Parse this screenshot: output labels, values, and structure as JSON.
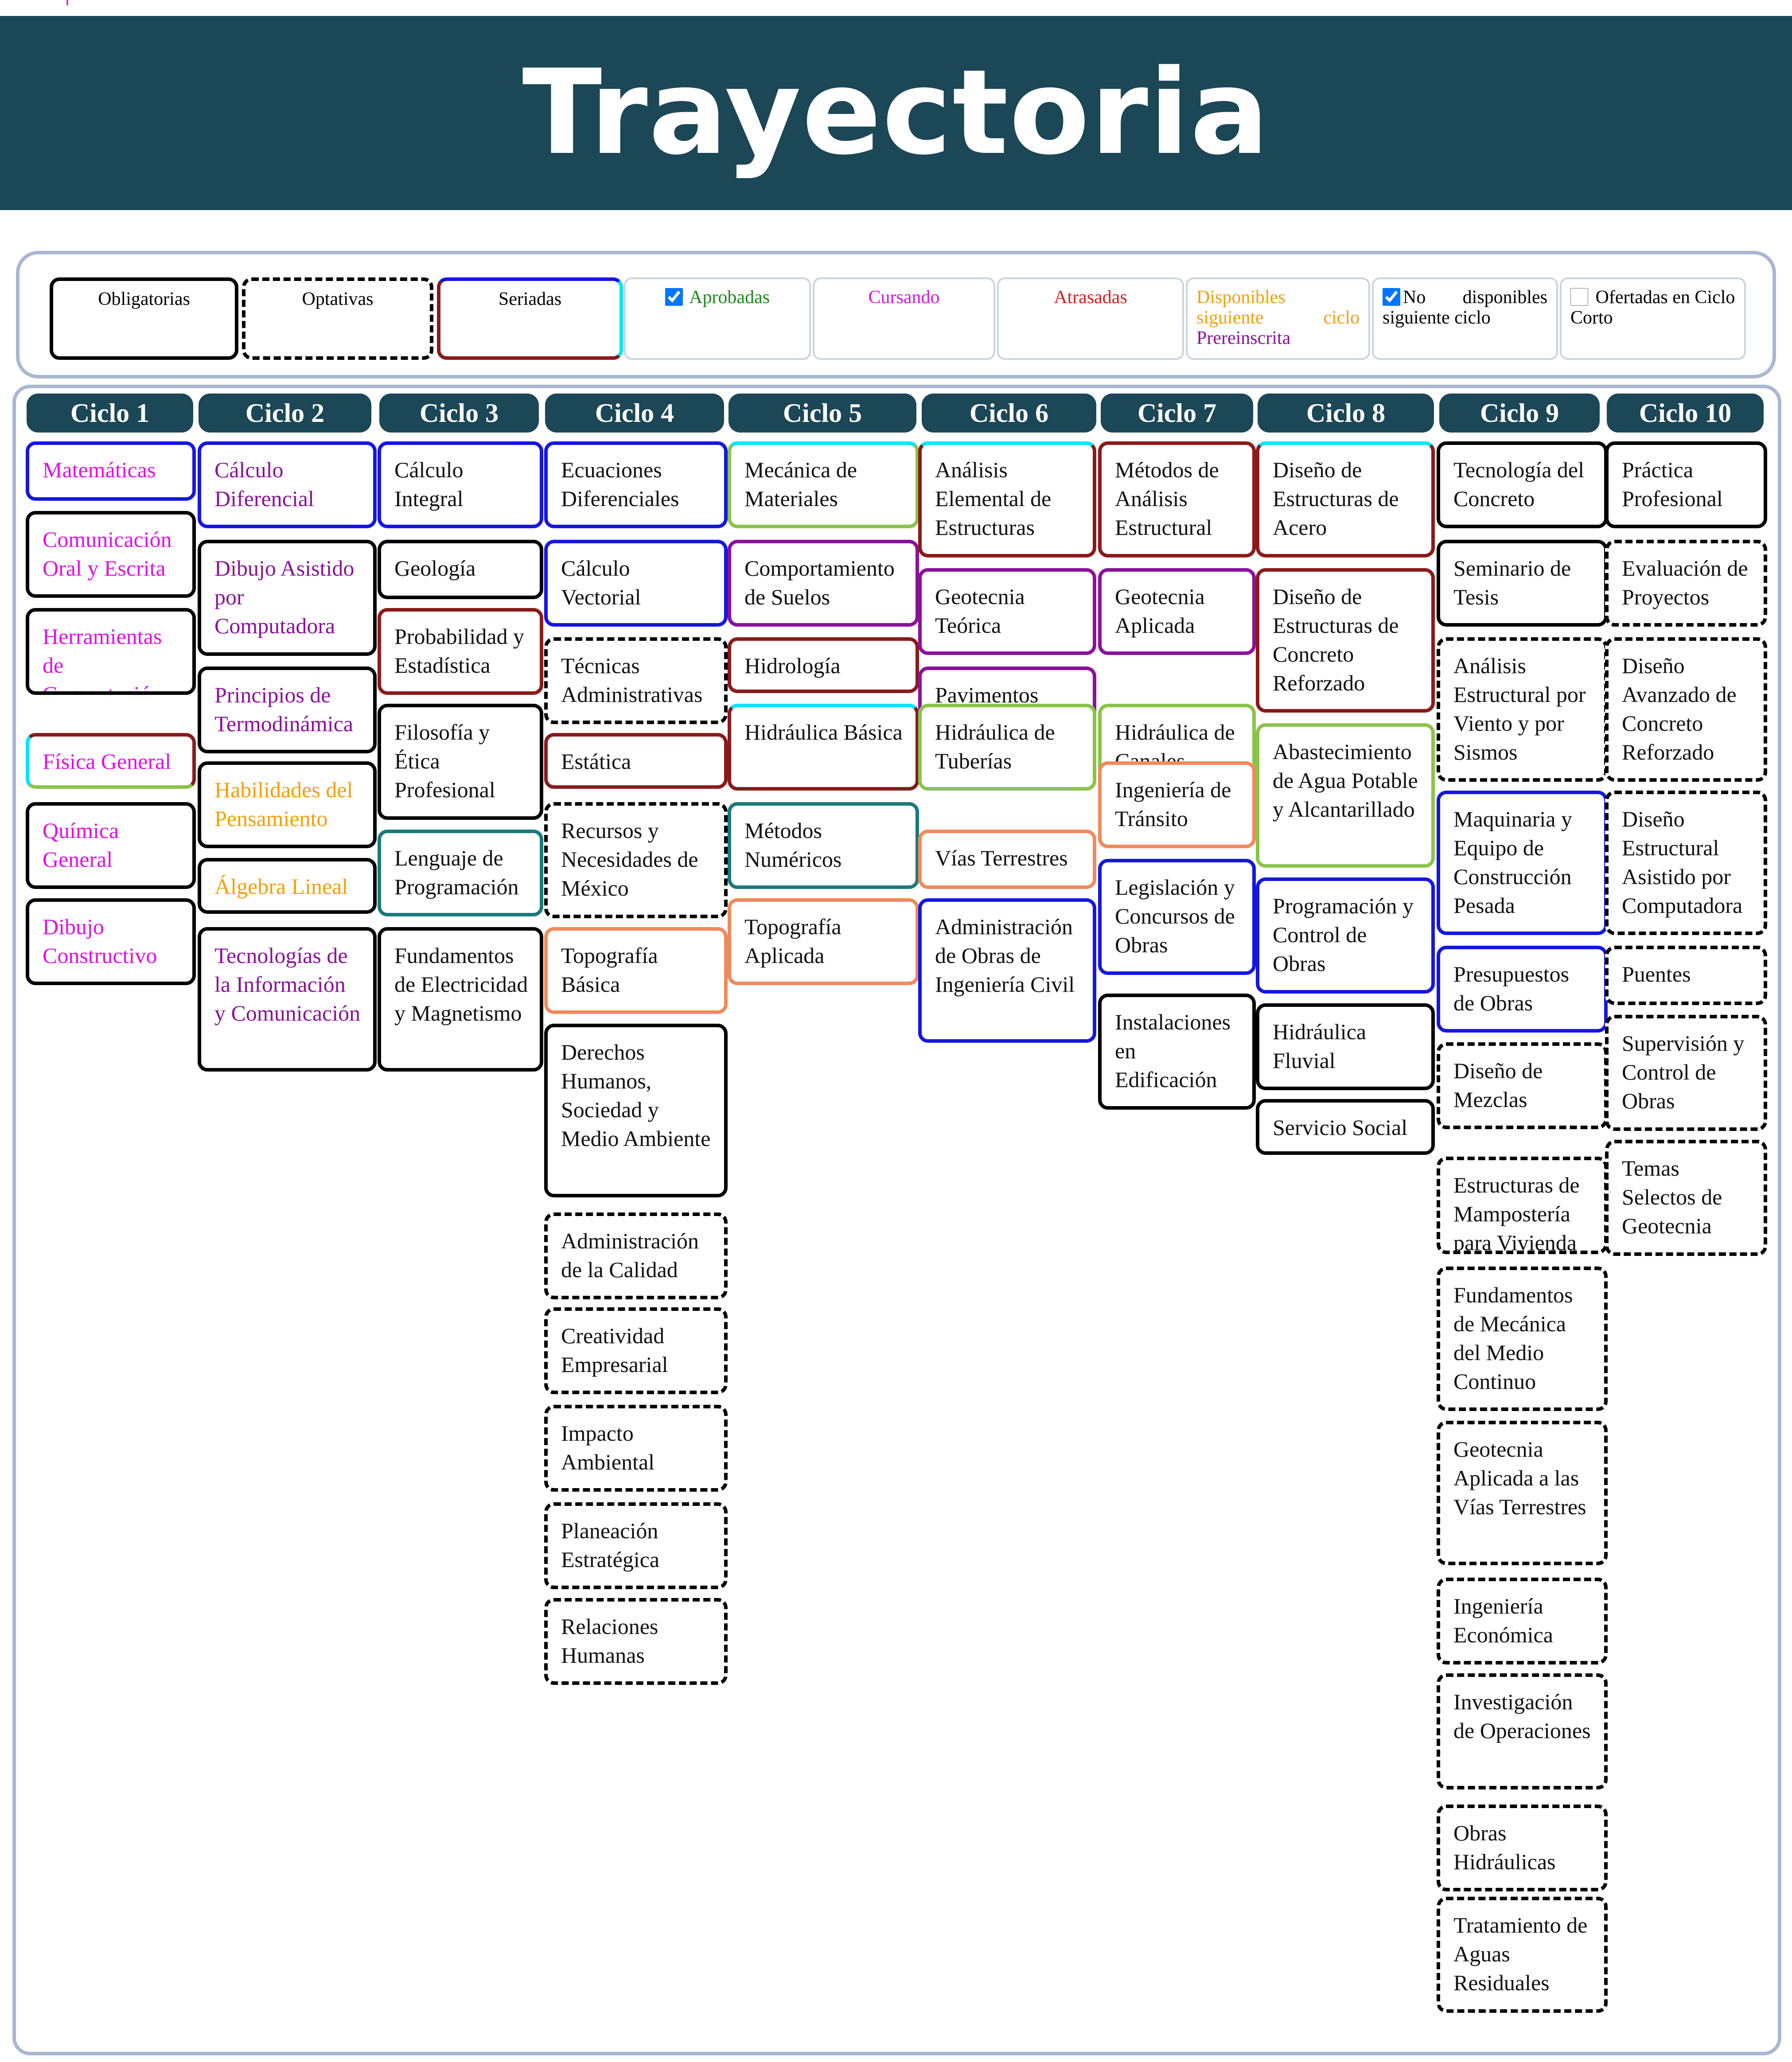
{
  "page": {
    "title": "Trayectoria"
  },
  "legend": {
    "obligatorias": "Obligatorias",
    "optativas": "Optativas",
    "seriadas": "Seriadas",
    "aprobadas": "Aprobadas",
    "aprobadas_checked": true,
    "cursando": "Cursando",
    "atrasadas": "Atrasadas",
    "disponibles_line1": "Disponibles",
    "disponibles_line2a": "siguiente",
    "disponibles_line2b": "ciclo",
    "prereinscrita": "Prereinscrita",
    "no_disponibles_a": "No",
    "no_disponibles_b": "disponibles",
    "no_disponibles_line2": "siguiente ciclo",
    "no_disponibles_checked": true,
    "ofertadas": "Ofertadas en Ciclo Corto",
    "ofertadas_checked": false
  },
  "colors": {
    "header_bg": "#1b4756",
    "panel_border": "#a9b7d3",
    "magenta_text": "#e20fe5",
    "purple_text": "#8b119b",
    "orange_text": "#f59e0b",
    "green_text": "#1a8a1a",
    "red_text": "#e01b1b",
    "border_black": "#000000",
    "border_blue": "#1616e0",
    "border_darkred": "#8b1a1a",
    "border_purple": "#8b119b",
    "border_teal": "#1b7a7a",
    "border_lime": "#8bc34a",
    "border_salmon": "#f08a5d",
    "border_cyan": "#00e5ff"
  },
  "cycles": [
    {
      "label": "Ciclo 1",
      "courses": [
        {
          "name": "Matemáticas",
          "text": "magenta",
          "border": "blue",
          "style": "solid"
        },
        {
          "name": "Comunicación Oral y Escrita",
          "text": "magenta",
          "border": "black",
          "style": "solid"
        },
        {
          "name": "Herramientas de Computación",
          "text": "magenta",
          "border": "black",
          "style": "solid"
        },
        {
          "name": "Física General",
          "text": "magenta",
          "border": "red-cyan",
          "style": "solid"
        },
        {
          "name": "Química General",
          "text": "magenta",
          "border": "black",
          "style": "solid"
        },
        {
          "name": "Dibujo Constructivo",
          "text": "magenta",
          "border": "black",
          "style": "solid"
        }
      ]
    },
    {
      "label": "Ciclo 2",
      "courses": [
        {
          "name": "Cálculo Diferencial",
          "text": "purple",
          "border": "blue",
          "style": "solid"
        },
        {
          "name": "Dibujo Asistido por Computadora",
          "text": "purple",
          "border": "black",
          "style": "solid"
        },
        {
          "name": "Principios de Termodinámica",
          "text": "purple",
          "border": "black",
          "style": "solid"
        },
        {
          "name": "Habilidades del Pensamiento",
          "text": "orange",
          "border": "black",
          "style": "solid"
        },
        {
          "name": "Álgebra Lineal",
          "text": "orange",
          "border": "black",
          "style": "solid"
        },
        {
          "name": "Tecnologías de la Información y Comunicación",
          "text": "purple",
          "border": "black",
          "style": "solid"
        }
      ]
    },
    {
      "label": "Ciclo 3",
      "courses": [
        {
          "name": "Cálculo Integral",
          "text": "black",
          "border": "blue",
          "style": "solid"
        },
        {
          "name": "Geología",
          "text": "black",
          "border": "black",
          "style": "solid"
        },
        {
          "name": "Probabilidad y Estadística",
          "text": "black",
          "border": "darkred",
          "style": "solid"
        },
        {
          "name": "Filosofía y Ética Profesional",
          "text": "black",
          "border": "black",
          "style": "solid"
        },
        {
          "name": "Lenguaje de Programación",
          "text": "black",
          "border": "teal",
          "style": "solid"
        },
        {
          "name": "Fundamentos de Electricidad y Magnetismo",
          "text": "black",
          "border": "black",
          "style": "solid"
        }
      ]
    },
    {
      "label": "Ciclo 4",
      "courses": [
        {
          "name": "Ecuaciones Diferenciales",
          "text": "black",
          "border": "blue",
          "style": "solid"
        },
        {
          "name": "Cálculo Vectorial",
          "text": "black",
          "border": "blue",
          "style": "solid"
        },
        {
          "name": "Técnicas Administrativas",
          "text": "black",
          "border": "black",
          "style": "dashed"
        },
        {
          "name": "Estática",
          "text": "black",
          "border": "darkred",
          "style": "solid"
        },
        {
          "name": "Recursos y Necesidades de México",
          "text": "black",
          "border": "black",
          "style": "dashed"
        },
        {
          "name": "Topografía Básica",
          "text": "black",
          "border": "salmon",
          "style": "solid"
        },
        {
          "name": "Derechos Humanos, Sociedad y Medio Ambiente",
          "text": "black",
          "border": "black",
          "style": "solid"
        },
        {
          "name": "Administración de la Calidad",
          "text": "black",
          "border": "black",
          "style": "dashed"
        },
        {
          "name": "Creatividad Empresarial",
          "text": "black",
          "border": "black",
          "style": "dashed"
        },
        {
          "name": "Impacto Ambiental",
          "text": "black",
          "border": "black",
          "style": "dashed"
        },
        {
          "name": "Planeación Estratégica",
          "text": "black",
          "border": "black",
          "style": "dashed"
        },
        {
          "name": "Relaciones Humanas",
          "text": "black",
          "border": "black",
          "style": "dashed"
        }
      ]
    },
    {
      "label": "Ciclo 5",
      "courses": [
        {
          "name": "Mecánica de Materiales",
          "text": "black",
          "border": "cyan-lime",
          "style": "solid"
        },
        {
          "name": "Comportamiento de Suelos",
          "text": "black",
          "border": "purple",
          "style": "solid"
        },
        {
          "name": "Hidrología",
          "text": "black",
          "border": "darkred",
          "style": "solid"
        },
        {
          "name": "Hidráulica Básica",
          "text": "black",
          "border": "cyan-darkred",
          "style": "solid"
        },
        {
          "name": "Métodos Numéricos",
          "text": "black",
          "border": "teal",
          "style": "solid"
        },
        {
          "name": "Topografía Aplicada",
          "text": "black",
          "border": "salmon",
          "style": "solid"
        }
      ]
    },
    {
      "label": "Ciclo 6",
      "courses": [
        {
          "name": "Análisis Elemental de Estructuras",
          "text": "black",
          "border": "cyan-darkred",
          "style": "solid"
        },
        {
          "name": "Geotecnia Teórica",
          "text": "black",
          "border": "purple",
          "style": "solid"
        },
        {
          "name": "Pavimentos",
          "text": "black",
          "border": "purple",
          "style": "solid"
        },
        {
          "name": "Hidráulica de Tuberías",
          "text": "black",
          "border": "lime",
          "style": "solid"
        },
        {
          "name": "Vías Terrestres",
          "text": "black",
          "border": "salmon",
          "style": "solid"
        },
        {
          "name": "Administración de Obras de Ingeniería Civil",
          "text": "black",
          "border": "blue",
          "style": "solid"
        }
      ]
    },
    {
      "label": "Ciclo 7",
      "courses": [
        {
          "name": "Métodos de Análisis Estructural",
          "text": "black",
          "border": "darkred",
          "style": "solid"
        },
        {
          "name": "Geotecnia Aplicada",
          "text": "black",
          "border": "purple",
          "style": "solid"
        },
        {
          "name": "Hidráulica de Canales",
          "text": "black",
          "border": "lime",
          "style": "solid"
        },
        {
          "name": "Ingeniería de Tránsito",
          "text": "black",
          "border": "salmon",
          "style": "solid"
        },
        {
          "name": "Legislación y Concursos de Obras",
          "text": "black",
          "border": "blue",
          "style": "solid"
        },
        {
          "name": "Instalaciones en Edificación",
          "text": "black",
          "border": "black",
          "style": "solid"
        }
      ]
    },
    {
      "label": "Ciclo 8",
      "courses": [
        {
          "name": "Diseño de Estructuras de Acero",
          "text": "black",
          "border": "cyan-darkred",
          "style": "solid"
        },
        {
          "name": "Diseño de Estructuras de Concreto Reforzado",
          "text": "black",
          "border": "darkred",
          "style": "solid"
        },
        {
          "name": "Abastecimiento de Agua Potable y Alcantarillado",
          "text": "black",
          "border": "lime",
          "style": "solid"
        },
        {
          "name": "Programación y Control de Obras",
          "text": "black",
          "border": "blue",
          "style": "solid"
        },
        {
          "name": "Hidráulica Fluvial",
          "text": "black",
          "border": "black",
          "style": "solid"
        },
        {
          "name": "Servicio Social",
          "text": "black",
          "border": "black",
          "style": "solid"
        }
      ]
    },
    {
      "label": "Ciclo 9",
      "courses": [
        {
          "name": "Tecnología del Concreto",
          "text": "black",
          "border": "black",
          "style": "solid"
        },
        {
          "name": "Seminario de Tesis",
          "text": "black",
          "border": "black",
          "style": "solid"
        },
        {
          "name": "Análisis Estructural por Viento y por Sismos",
          "text": "black",
          "border": "black",
          "style": "dashed"
        },
        {
          "name": "Maquinaria y Equipo de Construcción Pesada",
          "text": "black",
          "border": "blue",
          "style": "solid"
        },
        {
          "name": "Presupuestos de Obras",
          "text": "black",
          "border": "blue",
          "style": "solid"
        },
        {
          "name": "Diseño de Mezclas",
          "text": "black",
          "border": "black",
          "style": "dashed"
        },
        {
          "name": "Estructuras de Mampostería para Vivienda",
          "text": "black",
          "border": "black",
          "style": "dashed"
        },
        {
          "name": "Fundamentos de Mecánica del Medio Continuo",
          "text": "black",
          "border": "black",
          "style": "dashed"
        },
        {
          "name": "Geotecnia Aplicada a las Vías Terrestres",
          "text": "black",
          "border": "black",
          "style": "dashed"
        },
        {
          "name": "Ingeniería Económica",
          "text": "black",
          "border": "black",
          "style": "dashed"
        },
        {
          "name": "Investigación de Operaciones",
          "text": "black",
          "border": "black",
          "style": "dashed"
        },
        {
          "name": "Obras Hidráulicas",
          "text": "black",
          "border": "black",
          "style": "dashed"
        },
        {
          "name": "Tratamiento de Aguas Residuales",
          "text": "black",
          "border": "black",
          "style": "dashed"
        }
      ]
    },
    {
      "label": "Ciclo 10",
      "courses": [
        {
          "name": "Práctica Profesional",
          "text": "black",
          "border": "black",
          "style": "solid"
        },
        {
          "name": "Evaluación de Proyectos",
          "text": "black",
          "border": "black",
          "style": "dashed"
        },
        {
          "name": "Diseño Avanzado de Concreto Reforzado",
          "text": "black",
          "border": "black",
          "style": "dashed"
        },
        {
          "name": "Diseño Estructural Asistido por Computadora",
          "text": "black",
          "border": "black",
          "style": "dashed"
        },
        {
          "name": "Puentes",
          "text": "black",
          "border": "black",
          "style": "dashed"
        },
        {
          "name": "Supervisión y Control de Obras",
          "text": "black",
          "border": "black",
          "style": "dashed"
        },
        {
          "name": "Temas Selectos de Geotecnia",
          "text": "black",
          "border": "black",
          "style": "dashed"
        }
      ]
    }
  ]
}
